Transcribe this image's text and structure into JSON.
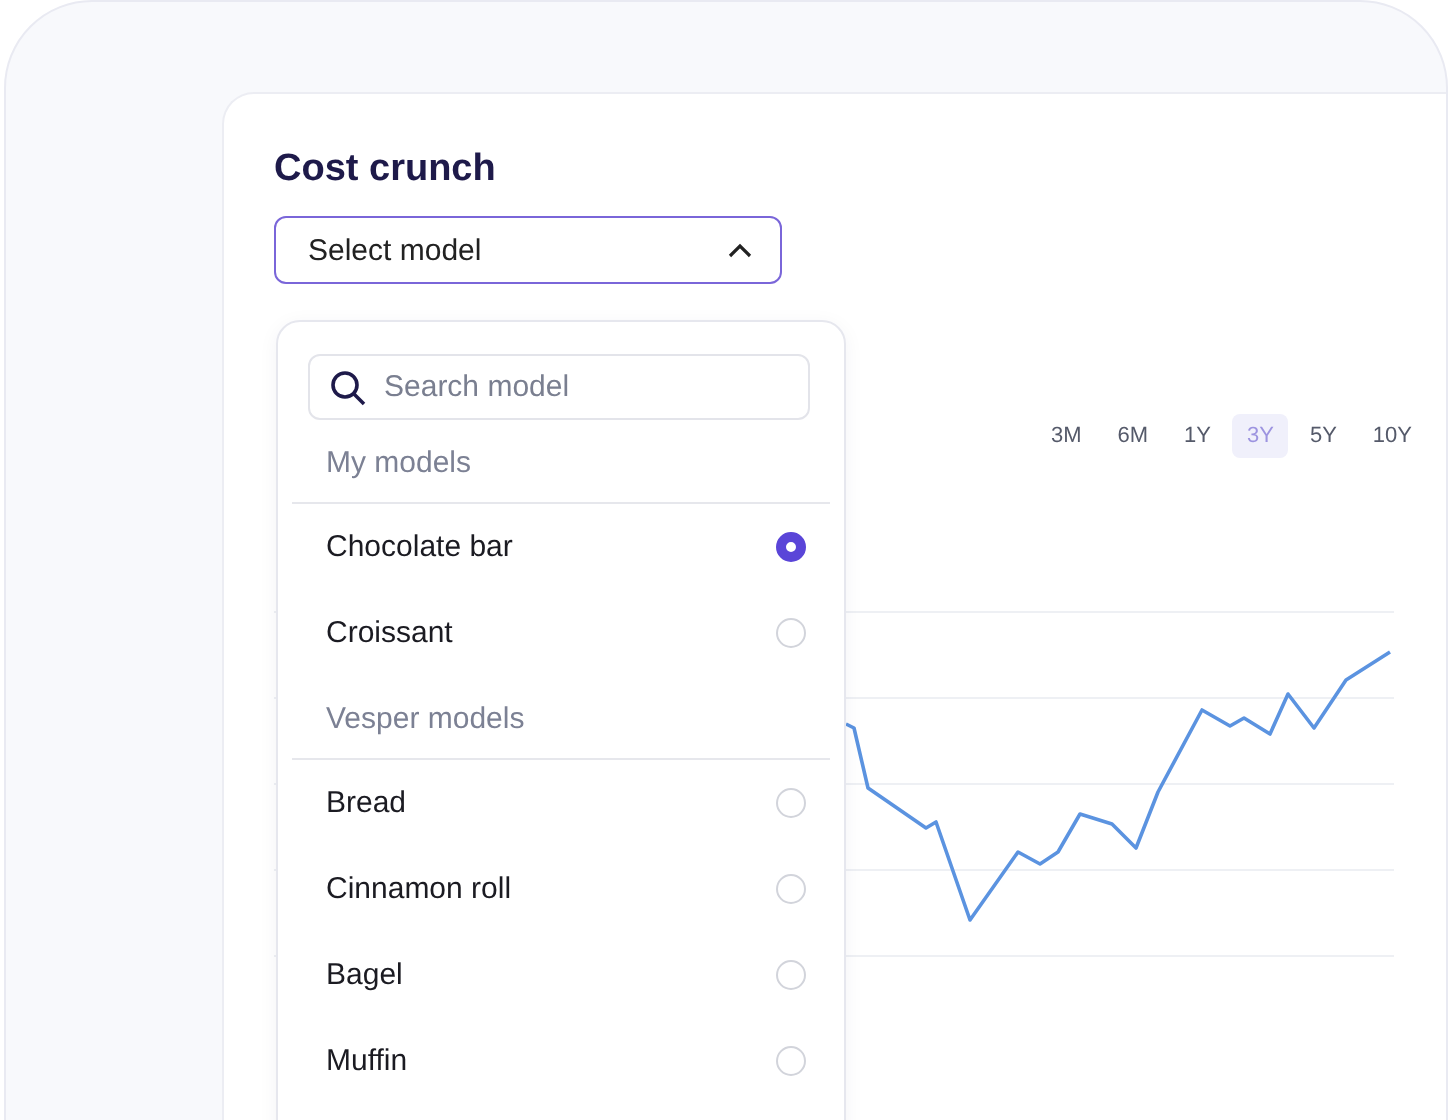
{
  "title": "Cost crunch",
  "select": {
    "label": "Select model",
    "expanded": true
  },
  "dropdown": {
    "search": {
      "placeholder": "Search model"
    },
    "groups": [
      {
        "heading": "My models",
        "items": [
          {
            "label": "Chocolate bar",
            "selected": true
          },
          {
            "label": "Croissant",
            "selected": false
          }
        ]
      },
      {
        "heading": "Vesper models",
        "items": [
          {
            "label": "Bread",
            "selected": false
          },
          {
            "label": "Cinnamon roll",
            "selected": false
          },
          {
            "label": "Bagel",
            "selected": false
          },
          {
            "label": "Muffin",
            "selected": false
          }
        ]
      }
    ]
  },
  "range_tabs": [
    {
      "label": "3M",
      "selected": false
    },
    {
      "label": "6M",
      "selected": false
    },
    {
      "label": "1Y",
      "selected": false
    },
    {
      "label": "3Y",
      "selected": true
    },
    {
      "label": "5Y",
      "selected": false
    },
    {
      "label": "10Y",
      "selected": false
    }
  ]
}
